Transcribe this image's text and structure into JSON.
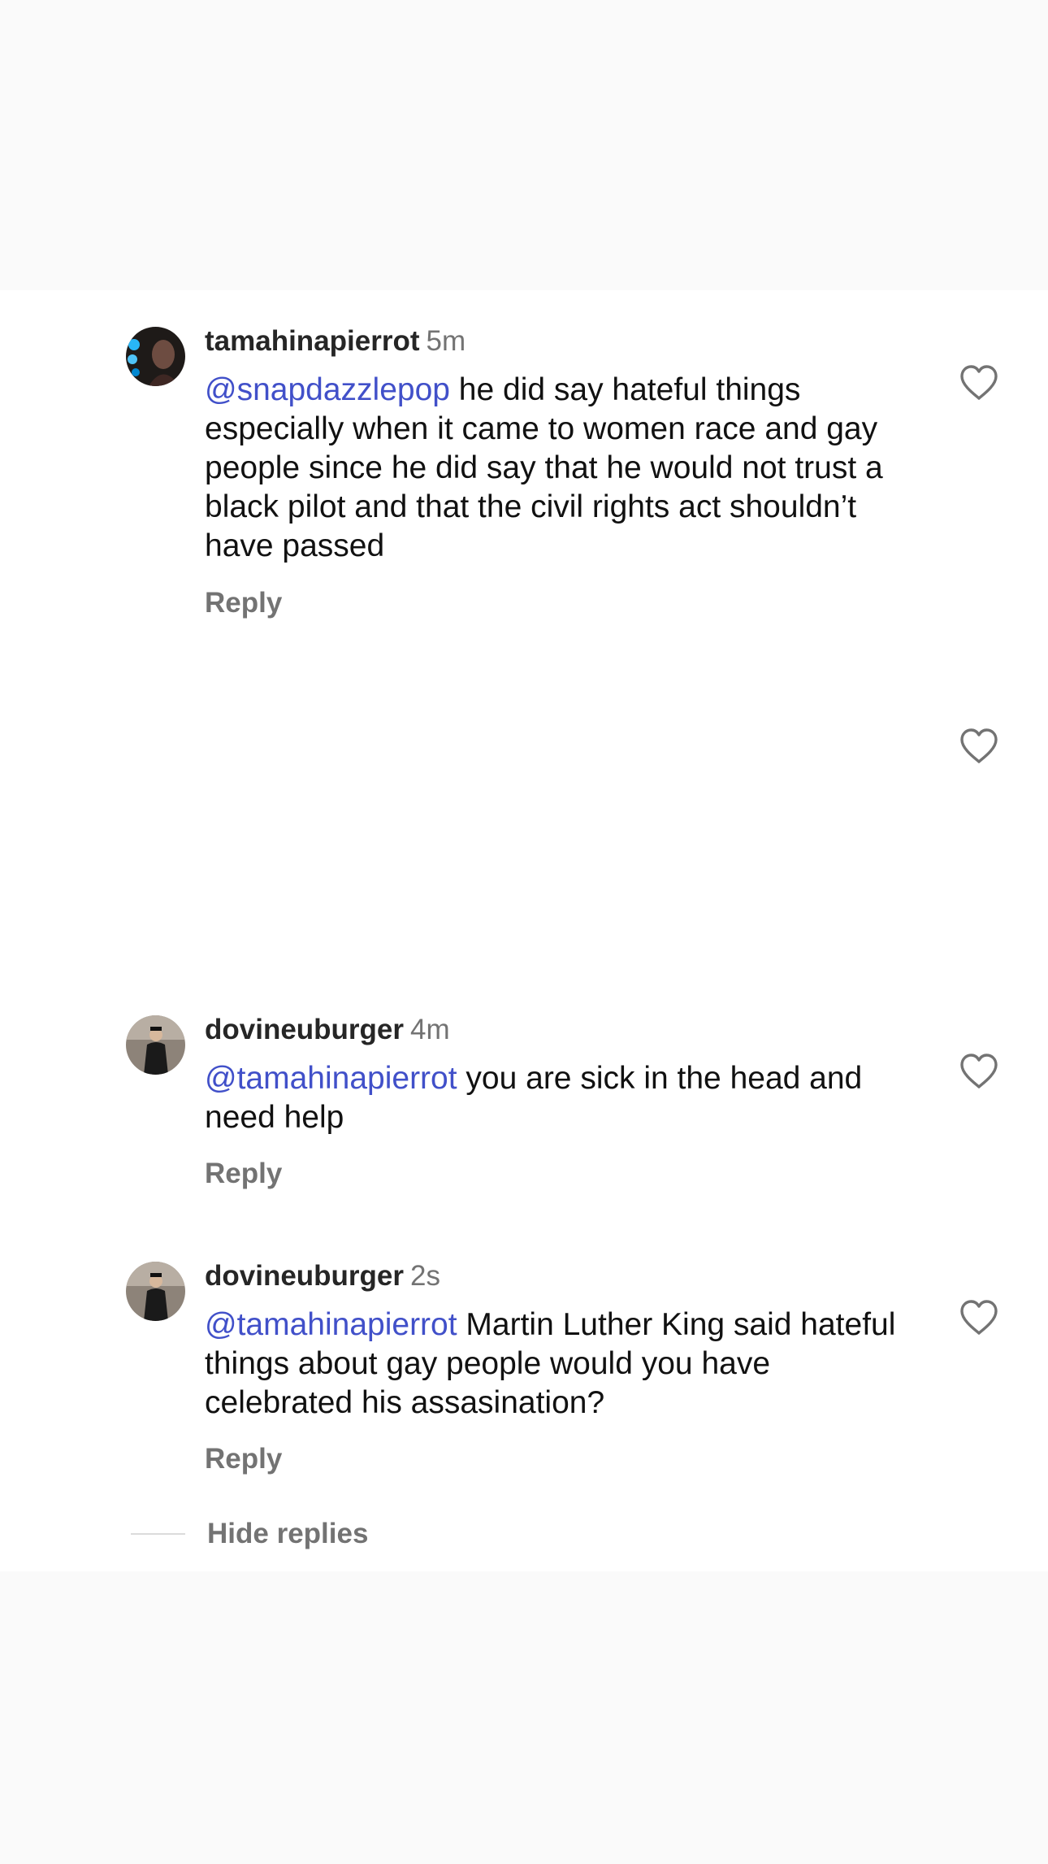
{
  "comments": [
    {
      "username": "tamahinapierrot",
      "time": "5m",
      "mention": "@snapdazzlepop",
      "text": " he did say hateful things especially when it came to women race and gay people since he did say that he would not trust a black pilot and that the civil rights act shouldn’t have passed",
      "reply_label": "Reply"
    },
    {
      "username": "dovineuburger",
      "time": "4m",
      "mention": "@tamahinapierrot",
      "text": " you are sick in the head and need help",
      "reply_label": "Reply"
    },
    {
      "username": "dovineuburger",
      "time": "2s",
      "mention": "@tamahinapierrot",
      "text": " Martin Luther King said hateful things about gay people would you have celebrated his assasination?",
      "reply_label": "Reply"
    }
  ],
  "hide_replies_label": "Hide replies",
  "icons": {
    "like": "heart-outline-icon",
    "avatar": "user-avatar"
  },
  "colors": {
    "mention": "#4150c9",
    "username": "#262626",
    "secondary": "#737373",
    "page_background": "#fafafa",
    "panel_background": "#ffffff"
  }
}
